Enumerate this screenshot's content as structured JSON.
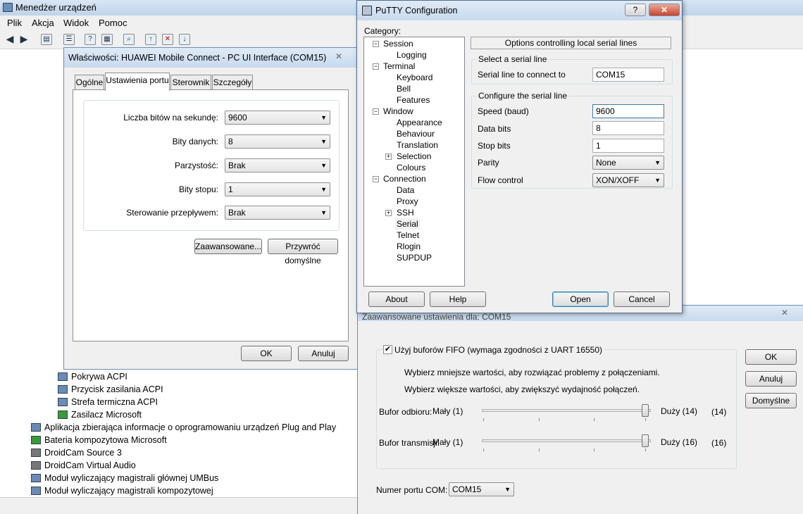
{
  "device_manager": {
    "title": "Menedżer urządzeń",
    "menu": [
      "Plik",
      "Akcja",
      "Widok",
      "Pomoc"
    ],
    "tree_items": [
      "Pokrywa ACPI",
      "Przycisk zasilania ACPI",
      "Strefa termiczna ACPI",
      "Zasilacz Microsoft",
      "Aplikacja zbierająca informacje o oprogramowaniu urządzeń Plug and Play",
      "Bateria kompozytowa Microsoft",
      "DroidCam Source 3",
      "DroidCam Virtual Audio",
      "Moduł wyliczający magistrali głównej UMBus",
      "Moduł wyliczający magistrali kompozytowej"
    ]
  },
  "properties": {
    "title": "Właściwości: HUAWEI Mobile Connect - PC UI Interface (COM15)",
    "close": "✕",
    "tabs": [
      "Ogólne",
      "Ustawienia portu",
      "Sterownik",
      "Szczegóły"
    ],
    "fields": [
      {
        "label": "Liczba bitów na sekundę:",
        "value": "9600"
      },
      {
        "label": "Bity danych:",
        "value": "8"
      },
      {
        "label": "Parzystość:",
        "value": "Brak"
      },
      {
        "label": "Bity stopu:",
        "value": "1"
      },
      {
        "label": "Sterowanie przepływem:",
        "value": "Brak"
      }
    ],
    "advanced": "Zaawansowane...",
    "restore": "Przywróć domyślne",
    "ok": "OK",
    "cancel": "Anuluj"
  },
  "putty": {
    "title": "PuTTY Configuration",
    "help_btn": "?",
    "close": "✕",
    "category_label": "Category:",
    "tree": [
      {
        "label": "Session",
        "level": 0
      },
      {
        "label": "Logging",
        "level": 1
      },
      {
        "label": "Terminal",
        "level": 0
      },
      {
        "label": "Keyboard",
        "level": 1
      },
      {
        "label": "Bell",
        "level": 1
      },
      {
        "label": "Features",
        "level": 1
      },
      {
        "label": "Window",
        "level": 0
      },
      {
        "label": "Appearance",
        "level": 1
      },
      {
        "label": "Behaviour",
        "level": 1
      },
      {
        "label": "Translation",
        "level": 1
      },
      {
        "label": "Selection",
        "level": 1
      },
      {
        "label": "Colours",
        "level": 1
      },
      {
        "label": "Connection",
        "level": 0
      },
      {
        "label": "Data",
        "level": 1
      },
      {
        "label": "Proxy",
        "level": 1
      },
      {
        "label": "SSH",
        "level": 1
      },
      {
        "label": "Serial",
        "level": 1
      },
      {
        "label": "Telnet",
        "level": 1
      },
      {
        "label": "Rlogin",
        "level": 1
      },
      {
        "label": "SUPDUP",
        "level": 1
      }
    ],
    "panel_header": "Options controlling local serial lines",
    "select_group": "Select a serial line",
    "serial_line_label": "Serial line to connect to",
    "serial_line_value": "COM15",
    "configure_group": "Configure the serial line",
    "speed_label": "Speed (baud)",
    "speed_value": "9600",
    "databits_label": "Data bits",
    "databits_value": "8",
    "stopbits_label": "Stop bits",
    "stopbits_value": "1",
    "parity_label": "Parity",
    "parity_value": "None",
    "flow_label": "Flow control",
    "flow_value": "XON/XOFF",
    "about": "About",
    "help": "Help",
    "open": "Open",
    "cancel": "Cancel"
  },
  "advanced": {
    "title": "Zaawansowane ustawienia dla: COM15",
    "close": "✕",
    "fifo_label": "Użyj buforów FIFO (wymaga zgodności z UART 16550)",
    "hint1": "Wybierz mniejsze wartości, aby rozwiązać problemy z połączeniami.",
    "hint2": "Wybierz większe wartości, aby zwiększyć wydajność połączeń.",
    "rx_label": "Bufor odbioru:",
    "rx_min": "Mały (1)",
    "rx_max": "Duży (14)",
    "rx_value": "(14)",
    "tx_label": "Bufor transmisji:",
    "tx_min": "Mały (1)",
    "tx_max": "Duży (16)",
    "tx_value": "(16)",
    "com_label": "Numer portu COM:",
    "com_value": "COM15",
    "ok": "OK",
    "cancel": "Anuluj",
    "defaults": "Domyślne"
  }
}
